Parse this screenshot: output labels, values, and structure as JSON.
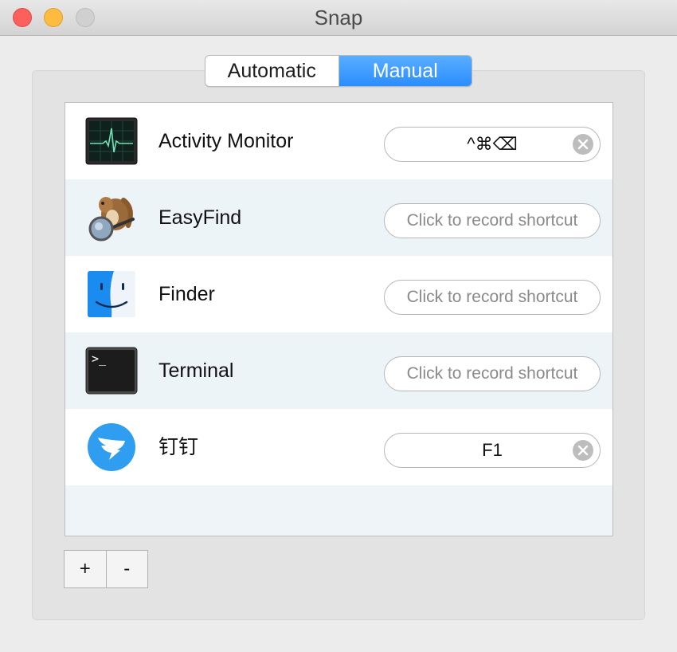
{
  "window": {
    "title": "Snap"
  },
  "tabs": [
    {
      "label": "Automatic",
      "active": false
    },
    {
      "label": "Manual",
      "active": true
    }
  ],
  "apps": [
    {
      "name": "Activity Monitor",
      "icon": "activity-monitor-icon",
      "shortcut": "^⌘⌫",
      "has_shortcut": true
    },
    {
      "name": "EasyFind",
      "icon": "easyfind-icon",
      "shortcut": "Click to record shortcut",
      "has_shortcut": false
    },
    {
      "name": "Finder",
      "icon": "finder-icon",
      "shortcut": "Click to record shortcut",
      "has_shortcut": false
    },
    {
      "name": "Terminal",
      "icon": "terminal-icon",
      "shortcut": "Click to record shortcut",
      "has_shortcut": false
    },
    {
      "name": "钉钉",
      "icon": "dingtalk-icon",
      "shortcut": "F1",
      "has_shortcut": true
    }
  ],
  "terminal_prompt": ">_",
  "controls": {
    "add_label": "+",
    "remove_label": "-"
  },
  "colors": {
    "accent": "#2a8dff",
    "close": "#fc605c",
    "minimize": "#fdbc40",
    "zoom": "#d0d0d0"
  }
}
